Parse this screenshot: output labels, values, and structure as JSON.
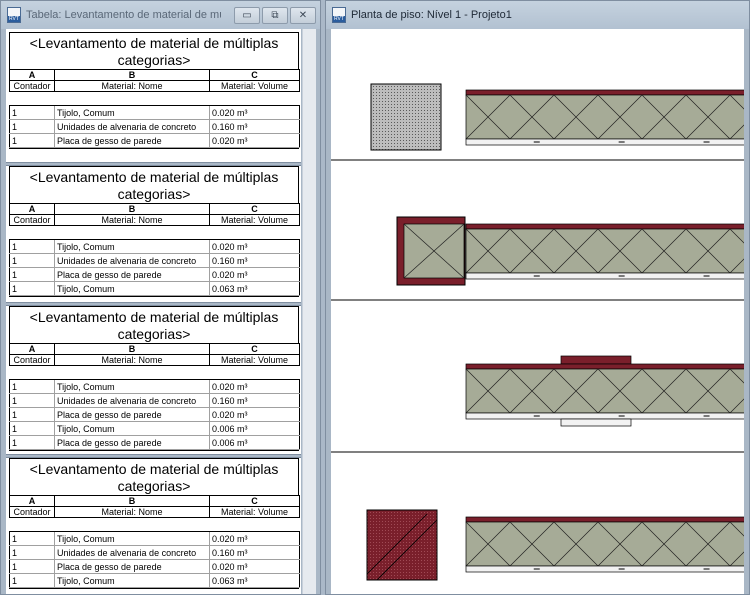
{
  "left_window": {
    "title": "Tabela: Levantamento de material de múl...",
    "controls": {
      "minimize": "▭",
      "restore": "⧉",
      "close": "✕"
    }
  },
  "right_window": {
    "title": "Planta de piso: Nível 1 - Projeto1"
  },
  "schedules": [
    {
      "title": "<Levantamento de material de múltiplas categorias>",
      "letters": [
        "A",
        "B",
        "C"
      ],
      "headers": [
        "Contador",
        "Material: Nome",
        "Material: Volume"
      ],
      "rows": [
        [
          "1",
          "Tijolo, Comum",
          "0.020 m³"
        ],
        [
          "1",
          "Unidades de alvenaria de concreto",
          "0.160 m³"
        ],
        [
          "1",
          "Placa de gesso de parede",
          "0.020 m³"
        ]
      ]
    },
    {
      "title": "<Levantamento de material de múltiplas categorias>",
      "letters": [
        "A",
        "B",
        "C"
      ],
      "headers": [
        "Contador",
        "Material: Nome",
        "Material: Volume"
      ],
      "rows": [
        [
          "1",
          "Tijolo, Comum",
          "0.020 m³"
        ],
        [
          "1",
          "Unidades de alvenaria de concreto",
          "0.160 m³"
        ],
        [
          "1",
          "Placa de gesso de parede",
          "0.020 m³"
        ],
        [
          "1",
          "Tijolo, Comum",
          "0.063 m³"
        ]
      ]
    },
    {
      "title": "<Levantamento de material de múltiplas categorias>",
      "letters": [
        "A",
        "B",
        "C"
      ],
      "headers": [
        "Contador",
        "Material: Nome",
        "Material: Volume"
      ],
      "rows": [
        [
          "1",
          "Tijolo, Comum",
          "0.020 m³"
        ],
        [
          "1",
          "Unidades de alvenaria de concreto",
          "0.160 m³"
        ],
        [
          "1",
          "Placa de gesso de parede",
          "0.020 m³"
        ],
        [
          "1",
          "Tijolo, Comum",
          "0.006 m³"
        ],
        [
          "1",
          "Placa de gesso de parede",
          "0.006 m³"
        ]
      ]
    },
    {
      "title": "<Levantamento de material de múltiplas categorias>",
      "letters": [
        "A",
        "B",
        "C"
      ],
      "headers": [
        "Contador",
        "Material: Nome",
        "Material: Volume"
      ],
      "rows": [
        [
          "1",
          "Tijolo, Comum",
          "0.020 m³"
        ],
        [
          "1",
          "Unidades de alvenaria de concreto",
          "0.160 m³"
        ],
        [
          "1",
          "Placa de gesso de parede",
          "0.020 m³"
        ],
        [
          "1",
          "Tijolo, Comum",
          "0.063 m³"
        ]
      ]
    }
  ],
  "colors": {
    "brick": "#7a1f2b",
    "concrete": "#a6ab97",
    "gypsum": "#f2f2f2",
    "hatch_gray": "#8a8a8a"
  }
}
